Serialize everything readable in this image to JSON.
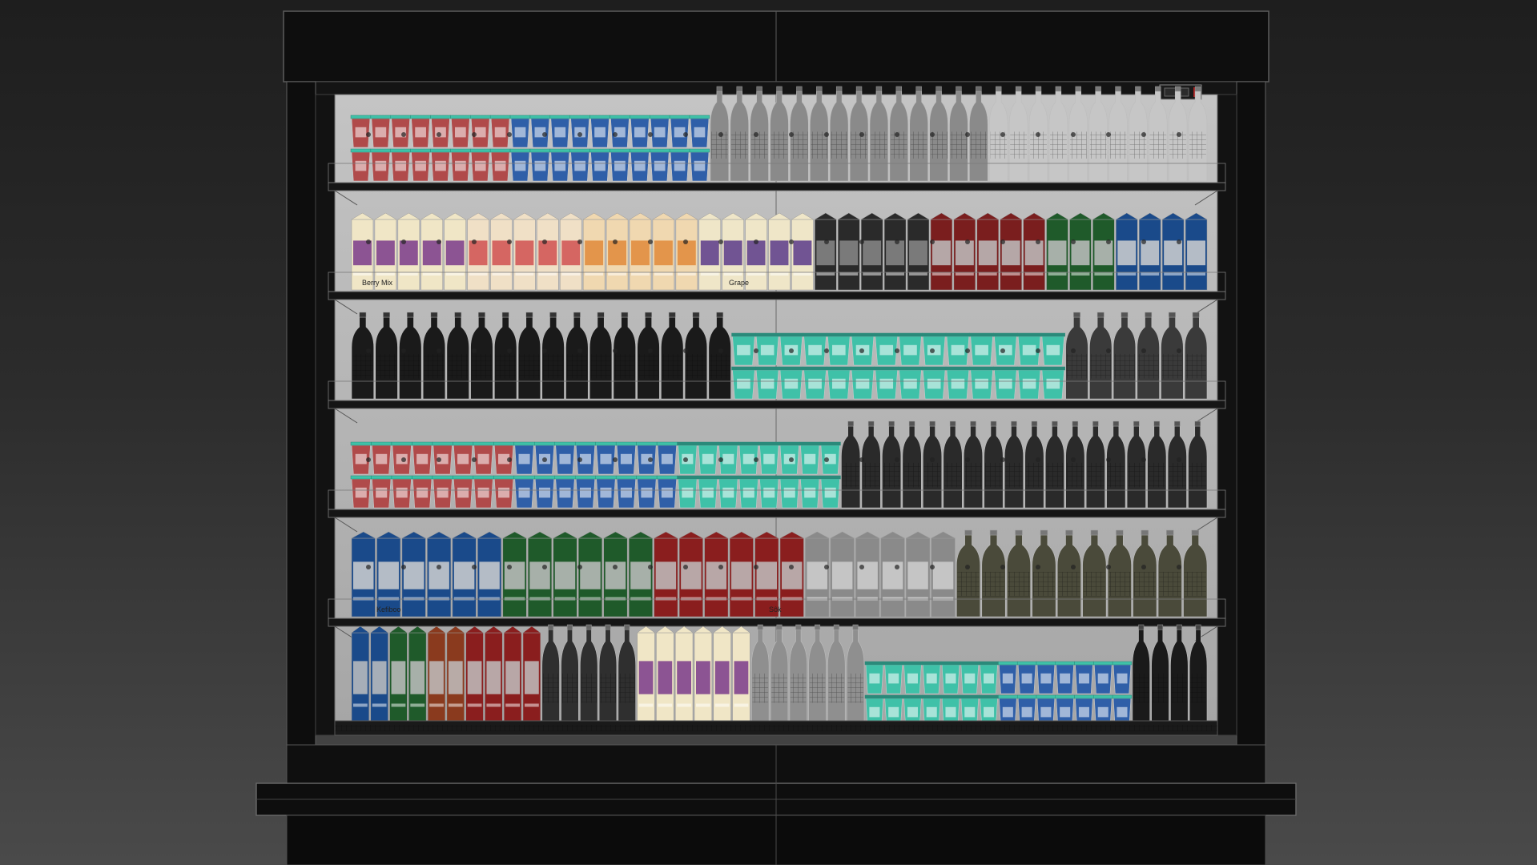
{
  "scene": {
    "subject": "open-front-refrigerated-display-cooler",
    "render_style": "3d-viewport-wireframe",
    "colors": {
      "background_top": "#1e1e1e",
      "background_bottom": "#4a4a4a",
      "cabinet": "#111111",
      "wire": "#5a5a5a",
      "back_panel": "#b5b5b5",
      "tray_teal": "#3fc1a8",
      "bottle_outline": "#9a9a9a"
    },
    "shelf_count": 6
  },
  "labels": {
    "berry_mix": "Berry Mix",
    "grape": "Grape",
    "brand": "Kefiboo",
    "sok": "Sôk"
  },
  "shelves": [
    {
      "name": "shelf-1",
      "groups": [
        {
          "kind": "cup",
          "color": "#b04a4a",
          "lid": "#3fc1a8",
          "count": 8
        },
        {
          "kind": "cup",
          "color": "#2f5fa8",
          "lid": "#3fc1a8",
          "count": 10
        },
        {
          "kind": "bottle",
          "color": "#8a8a8a",
          "cap": "#6a6a6a",
          "count": 14
        },
        {
          "kind": "bottle",
          "color": "#c6c6c6",
          "cap": "#7a7a7a",
          "count": 11
        }
      ]
    },
    {
      "name": "shelf-2",
      "groups": [
        {
          "kind": "carton",
          "color": "#f0e6c6",
          "accent": "#7a3a8a",
          "label": "Berry Mix",
          "count": 5
        },
        {
          "kind": "carton",
          "color": "#f0e0c6",
          "accent": "#d05050",
          "count": 5
        },
        {
          "kind": "carton",
          "color": "#f0d8b0",
          "accent": "#e08a3a",
          "count": 5
        },
        {
          "kind": "carton",
          "color": "#efe6c8",
          "accent": "#5a3a8a",
          "label": "Grape",
          "count": 5
        },
        {
          "kind": "carton",
          "color": "#2a2a2a",
          "accent": "#888888",
          "count": 5
        },
        {
          "kind": "carton",
          "color": "#7a1e1e",
          "accent": "#c0c0c0",
          "count": 5
        },
        {
          "kind": "carton",
          "color": "#1f5a2a",
          "accent": "#c0c0c0",
          "count": 3
        },
        {
          "kind": "carton",
          "color": "#1a4a8a",
          "accent": "#d0d0d0",
          "count": 4
        }
      ]
    },
    {
      "name": "shelf-3",
      "groups": [
        {
          "kind": "bottle",
          "color": "#1a1a1a",
          "cap": "#333333",
          "count": 16
        },
        {
          "kind": "cup",
          "color": "#3fc1a8",
          "lid": "#2a8a7a",
          "count": 14
        },
        {
          "kind": "bottle",
          "color": "#3a3a3a",
          "cap": "#555555",
          "count": 6
        }
      ]
    },
    {
      "name": "shelf-4",
      "groups": [
        {
          "kind": "cup",
          "color": "#b04a4a",
          "lid": "#3fc1a8",
          "count": 8
        },
        {
          "kind": "cup",
          "color": "#2f5fa8",
          "lid": "#3fc1a8",
          "count": 8
        },
        {
          "kind": "cup",
          "color": "#3fc1a8",
          "lid": "#2a8a7a",
          "count": 8
        },
        {
          "kind": "bottle",
          "color": "#2a2a2a",
          "cap": "#555555",
          "count": 18
        }
      ]
    },
    {
      "name": "shelf-5",
      "groups": [
        {
          "kind": "carton",
          "color": "#1a4a8a",
          "accent": "#d0d0d0",
          "label": "Kefiboo",
          "count": 6
        },
        {
          "kind": "carton",
          "color": "#1f5a2a",
          "accent": "#c0c0c0",
          "count": 6
        },
        {
          "kind": "carton",
          "color": "#8a1e1e",
          "accent": "#c0c0c0",
          "label": "Sôk",
          "count": 6
        },
        {
          "kind": "carton",
          "color": "#8a8a8a",
          "accent": "#cfcfcf",
          "count": 6
        },
        {
          "kind": "bottle",
          "color": "#4a4a3a",
          "cap": "#777777",
          "count": 10
        }
      ]
    },
    {
      "name": "shelf-6",
      "groups": [
        {
          "kind": "carton",
          "color": "#1a4a8a",
          "accent": "#c0c0c0",
          "count": 2
        },
        {
          "kind": "carton",
          "color": "#1f5a2a",
          "accent": "#c0c0c0",
          "count": 2
        },
        {
          "kind": "carton",
          "color": "#8a3a1e",
          "accent": "#c0c0c0",
          "count": 2
        },
        {
          "kind": "carton",
          "color": "#8a1e1e",
          "accent": "#c0c0c0",
          "count": 4
        },
        {
          "kind": "bottle",
          "color": "#2f2f2f",
          "cap": "#666666",
          "count": 5
        },
        {
          "kind": "carton",
          "color": "#f0e6c6",
          "accent": "#7a3a8a",
          "count": 6
        },
        {
          "kind": "bottle",
          "color": "#8f8f8f",
          "cap": "#777777",
          "count": 6
        },
        {
          "kind": "cup",
          "color": "#3fc1a8",
          "lid": "#2a8a7a",
          "count": 7
        },
        {
          "kind": "cup",
          "color": "#2f5fa8",
          "lid": "#3fc1a8",
          "count": 7
        },
        {
          "kind": "bottle",
          "color": "#1a1a1a",
          "cap": "#444444",
          "count": 4
        }
      ]
    }
  ]
}
